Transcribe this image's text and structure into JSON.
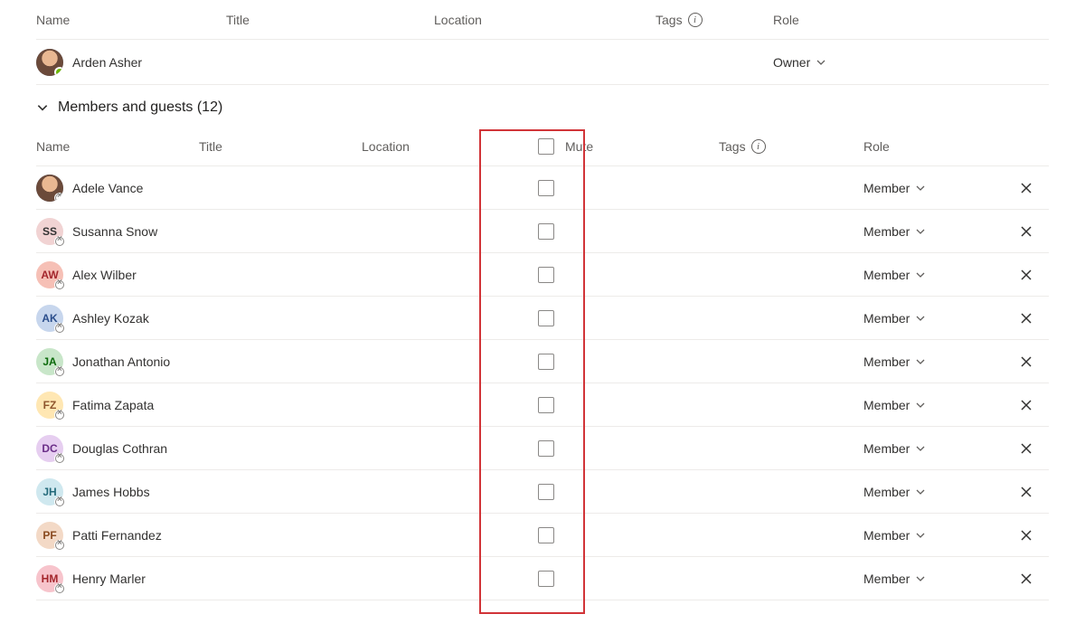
{
  "columns": {
    "name": "Name",
    "title": "Title",
    "location": "Location",
    "tags": "Tags",
    "role": "Role",
    "mute": "Mute"
  },
  "owner": {
    "name": "Arden Asher",
    "role": "Owner"
  },
  "section": {
    "label": "Members and guests (12)"
  },
  "members": [
    {
      "initials": "",
      "photo": true,
      "colorClass": "photo",
      "name": "Adele Vance",
      "role": "Member"
    },
    {
      "initials": "SS",
      "photo": false,
      "colorClass": "c-ss",
      "name": "Susanna Snow",
      "role": "Member"
    },
    {
      "initials": "AW",
      "photo": false,
      "colorClass": "c-aw",
      "name": "Alex Wilber",
      "role": "Member"
    },
    {
      "initials": "AK",
      "photo": false,
      "colorClass": "c-ak",
      "name": "Ashley Kozak",
      "role": "Member"
    },
    {
      "initials": "JA",
      "photo": false,
      "colorClass": "c-ja",
      "name": "Jonathan Antonio",
      "role": "Member"
    },
    {
      "initials": "FZ",
      "photo": false,
      "colorClass": "c-fz",
      "name": "Fatima Zapata",
      "role": "Member"
    },
    {
      "initials": "DC",
      "photo": false,
      "colorClass": "c-dc",
      "name": "Douglas Cothran",
      "role": "Member"
    },
    {
      "initials": "JH",
      "photo": false,
      "colorClass": "c-jh",
      "name": "James Hobbs",
      "role": "Member"
    },
    {
      "initials": "PF",
      "photo": false,
      "colorClass": "c-pf",
      "name": "Patti Fernandez",
      "role": "Member"
    },
    {
      "initials": "HM",
      "photo": false,
      "colorClass": "c-hm",
      "name": "Henry Marler",
      "role": "Member"
    }
  ]
}
